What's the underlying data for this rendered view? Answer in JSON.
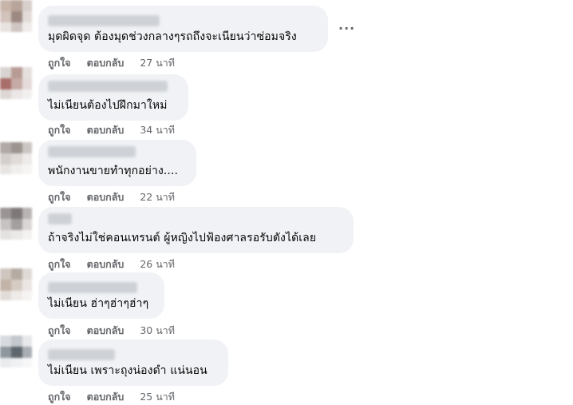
{
  "actions": {
    "like_label": "ถูกใจ",
    "reply_label": "ตอบกลับ"
  },
  "more_icon": "ellipsis-icon",
  "comments": [
    {
      "text": "มุดผิดจุด ต้องมุดช่วงกลางๆรถถึงจะเนียนว่าซ่อมจริง",
      "time": "27 นาที"
    },
    {
      "text": "ไม่เนียนต้องไปฝึกมาใหม่",
      "time": "34 นาที"
    },
    {
      "text": "พนักงานขายทำทุกอย่าง....",
      "time": "22 นาที"
    },
    {
      "text": "ถ้าจริงไม่ใช่คอนเทรนต์ ผู้หญิงไปฟ้องศาลรอรับตังได้เลย",
      "time": "26 นาที"
    },
    {
      "text": "ไม่เนียน ฮ่าๆฮ่าๆฮ่าๆ",
      "time": "30 นาที"
    },
    {
      "text": "ไม่เนียน เพราะถุงน่องดำ แน่นอน",
      "time": "25 นาที"
    }
  ]
}
